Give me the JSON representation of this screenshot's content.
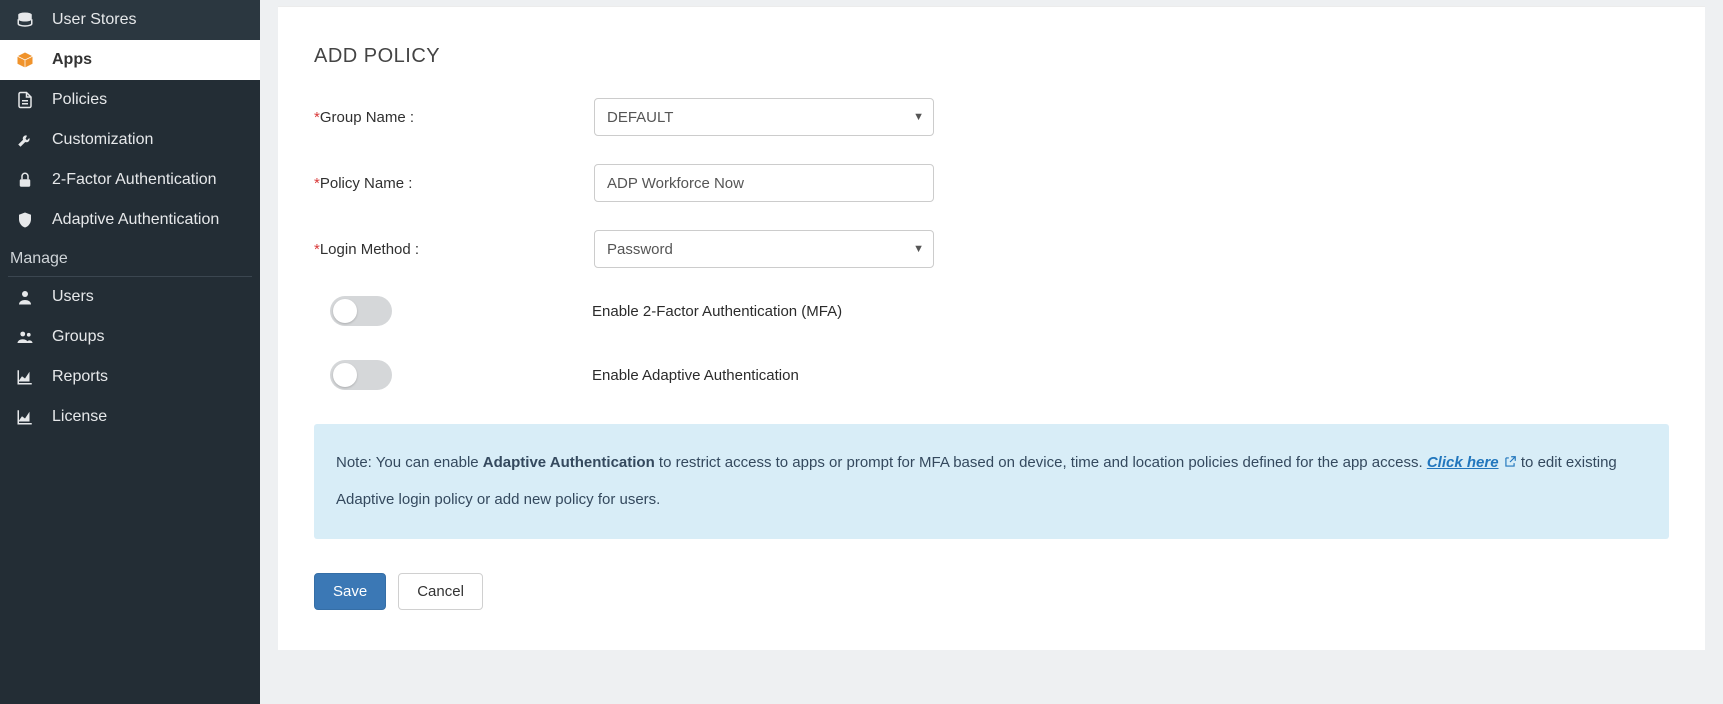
{
  "sidebar": {
    "items_top": [
      {
        "label": "User Stores",
        "icon": "database-icon"
      },
      {
        "label": "Apps",
        "icon": "box-icon"
      },
      {
        "label": "Policies",
        "icon": "document-icon"
      },
      {
        "label": "Customization",
        "icon": "wrench-icon"
      },
      {
        "label": "2-Factor Authentication",
        "icon": "lock-icon"
      },
      {
        "label": "Adaptive Authentication",
        "icon": "shield-icon"
      }
    ],
    "section_label": "Manage",
    "items_bottom": [
      {
        "label": "Users",
        "icon": "user-icon"
      },
      {
        "label": "Groups",
        "icon": "group-icon"
      },
      {
        "label": "Reports",
        "icon": "chart-icon"
      },
      {
        "label": "License",
        "icon": "chart-icon"
      }
    ]
  },
  "page": {
    "title": "ADD POLICY"
  },
  "form": {
    "group": {
      "label": "Group Name :",
      "value": "DEFAULT"
    },
    "policy": {
      "label": "Policy Name :",
      "value": "ADP Workforce Now"
    },
    "login_method": {
      "label": "Login Method :",
      "value": "Password"
    },
    "toggle_mfa": "Enable 2-Factor Authentication (MFA)",
    "toggle_adaptive": "Enable Adaptive Authentication"
  },
  "note": {
    "prefix": "Note: You can enable ",
    "bolded": "Adaptive Authentication",
    "mid": " to restrict access to apps or prompt for MFA based on device, time and location policies defined for the app access. ",
    "link_text": "Click here",
    "suffix": " to edit existing Adaptive login policy or add new policy for users."
  },
  "buttons": {
    "save": "Save",
    "cancel": "Cancel"
  }
}
